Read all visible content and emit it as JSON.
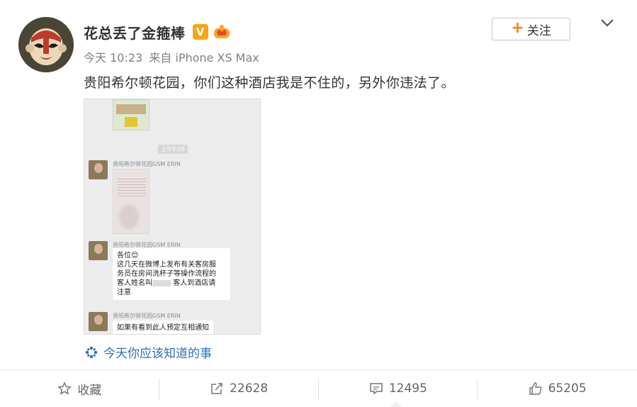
{
  "post": {
    "username": "花总丢了金箍棒",
    "verified_badge": "V",
    "timestamp": "今天 10:23",
    "source": "来自 iPhone XS Max",
    "text": "贵阳希尔顿花园，你们这种酒店我是不住的，另外你违法了。",
    "topic": "今天你应该知道的事"
  },
  "follow_button": {
    "label": "关注"
  },
  "chat": {
    "time": "上午9:26",
    "sender": "贵阳希尔顿花园GSM ERIN",
    "message1_lines": [
      "各位😊",
      "这几天在微博上发布有关客房服",
      "务员在房间洗杯子等操作流程的",
      "客人姓名叫",
      "客人到酒店请",
      "注意"
    ],
    "message2": "如果有看到此人预定互相通知"
  },
  "footer": {
    "favorite_label": "收藏",
    "repost_count": "22628",
    "comment_count": "12495",
    "like_count": "65205"
  },
  "colors": {
    "follow_plus": "#ff8200",
    "topic_link": "#2d6fb5",
    "vip_badge": "#f7a517"
  }
}
